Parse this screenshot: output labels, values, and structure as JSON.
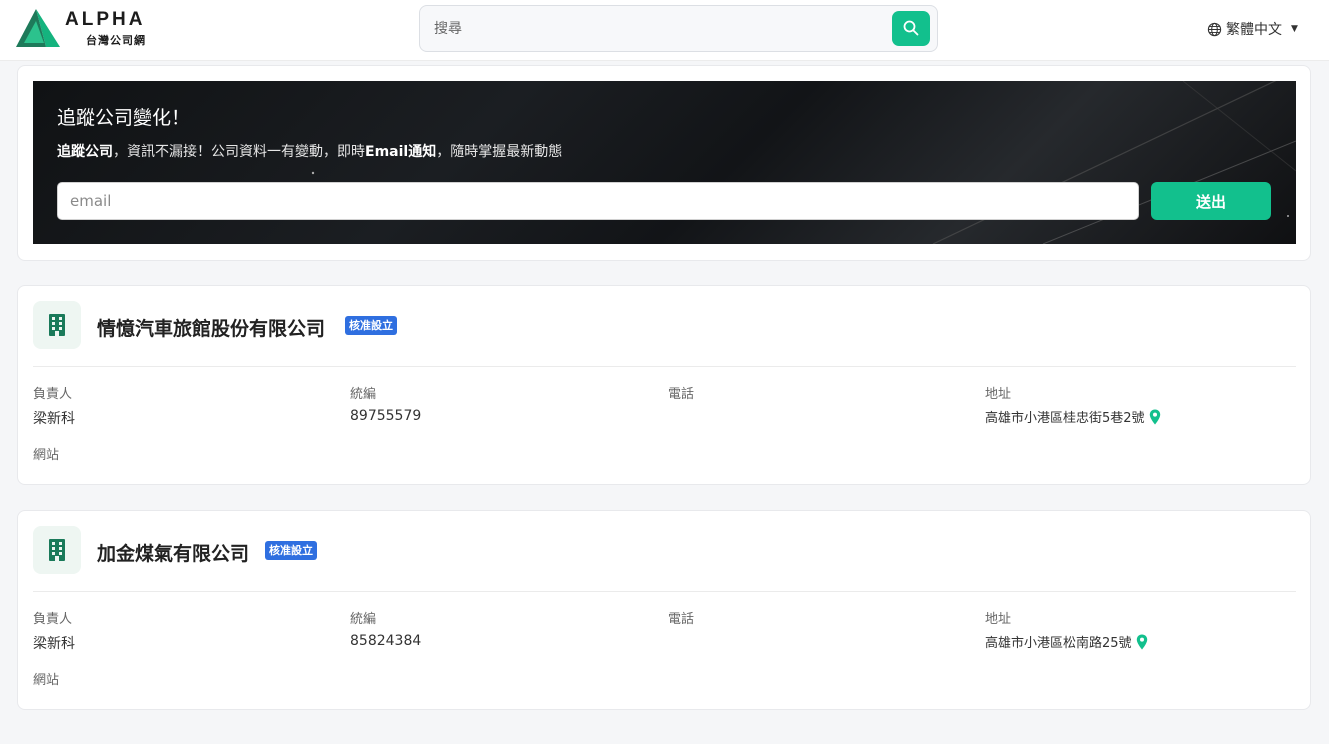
{
  "header": {
    "logo_en": "ALPHA",
    "logo_zh": "台灣公司網",
    "search_placeholder": "搜尋",
    "language": "繁體中文",
    "brand_color": "#12c08d"
  },
  "tracking": {
    "title": "追蹤公司變化！",
    "subtitle_bold1": "追蹤公司",
    "subtitle_text1": "，資訊不漏接！公司資料一有變動，即時",
    "subtitle_bold2": "Email通知",
    "subtitle_text2": "，隨時掌握最新動態",
    "email_placeholder": "email",
    "submit_label": "送出"
  },
  "labels": {
    "owner": "負責人",
    "tax_id": "統編",
    "phone": "電話",
    "address": "地址",
    "website": "網站"
  },
  "companies": [
    {
      "name": "情憶汽車旅館股份有限公司",
      "status": "核准設立",
      "owner": "梁新科",
      "tax_id": "89755579",
      "phone": "",
      "address": "高雄市小港區桂忠街5巷2號",
      "website": ""
    },
    {
      "name": "加金煤氣有限公司",
      "status": "核准設立",
      "owner": "梁新科",
      "tax_id": "85824384",
      "phone": "",
      "address": "高雄市小港區松南路25號",
      "website": ""
    }
  ]
}
